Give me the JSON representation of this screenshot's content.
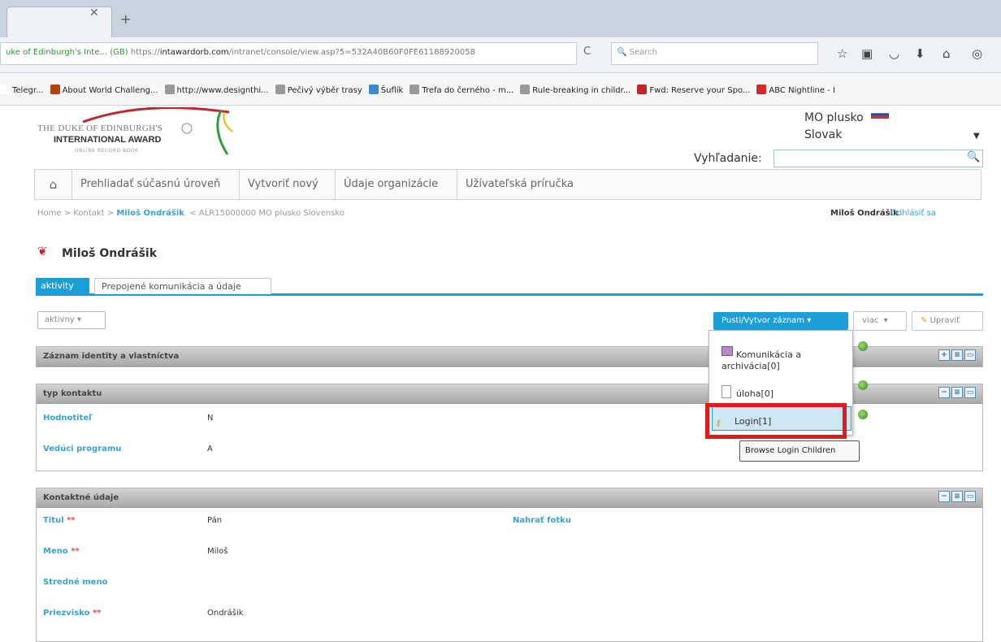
{
  "browser": {
    "url_site": "uke of Edinburgh's Inte... (GB)",
    "url_prefix": "https://",
    "url_domain": "intawardorb.com",
    "url_path": "/intranet/console/view.asp?5=532A40B60F0FE61188920058",
    "search_placeholder": "Search",
    "bookmarks": [
      {
        "label": "Telegr...",
        "color": "#ffffff"
      },
      {
        "label": "About World Challeng...",
        "color": "#b5410f"
      },
      {
        "label": "http://www.designthi...",
        "color": "#9a9a9a"
      },
      {
        "label": "Pečivý výběr trasy",
        "color": "#9a9a9a"
      },
      {
        "label": "Šuflík",
        "color": "#3a8bd0"
      },
      {
        "label": "Trefa do černého - m...",
        "color": "#9a9a9a"
      },
      {
        "label": "Rule-breaking in childr...",
        "color": "#9a9a9a"
      },
      {
        "label": "Fwd: Reserve your Spo...",
        "color": "#c0272d"
      },
      {
        "label": "ABC Nightline - I",
        "color": "#d12a2a"
      }
    ]
  },
  "header": {
    "logo_line1": "THE DUKE OF EDINBURGH'S",
    "logo_line2": "INTERNATIONAL AWARD",
    "logo_line3": "ONLINE RECORD BOOK",
    "org_name": "MO plusko",
    "language": "Slovak",
    "search_label": "Vyhľadanie:"
  },
  "nav": {
    "items": [
      "Prehliadať súčasnú úroveň",
      "Vytvoriť nový",
      "Údaje organizácie",
      "Užívateľská príručka"
    ]
  },
  "breadcrumb": {
    "home": "Home",
    "sep": ">",
    "contact": "Kontakt",
    "name": "Miloš Ondrášik",
    "lt": "<",
    "org": "ALR15000000 MO plusko Slovensko"
  },
  "user": {
    "name": "Miloš Ondrášik",
    "logout": "Odhlásiť sa"
  },
  "contact_name": "Miloš Ondrášik",
  "tabs": {
    "active": "aktivity",
    "second": "Prepojené komunikácia a údaje"
  },
  "filter": "aktivny",
  "toolbar": {
    "add": "Pusti/Vytvor záznam",
    "more": "viac",
    "edit": "Upraviť"
  },
  "dropdown": {
    "item1_line1": "Komunikácia a",
    "item1_line2": "archivácia[0]",
    "item2": "úloha[0]",
    "item3": "Login[1]",
    "tooltip": "Browse Login Children"
  },
  "sections": {
    "identity": "Záznam identity a vlastníctva",
    "type": "typ kontaktu",
    "contact": "Kontaktné údaje"
  },
  "type_fields": [
    {
      "label": "Hodnotiteľ",
      "value": "N"
    },
    {
      "label": "Vedúci programu",
      "value": "A"
    }
  ],
  "contact_fields": {
    "title_label": "Titul",
    "title_value": "Pán",
    "photo_label": "Nahrať fotku",
    "first_label": "Meno",
    "first_value": "Miloš",
    "middle_label": "Stredné meno",
    "last_label": "Priezvisko",
    "last_value": "Ondrášik",
    "req": "**"
  },
  "colors": {
    "accent": "#1c9fd6",
    "highlight": "#e01b1b",
    "link": "#3aa2cc"
  }
}
